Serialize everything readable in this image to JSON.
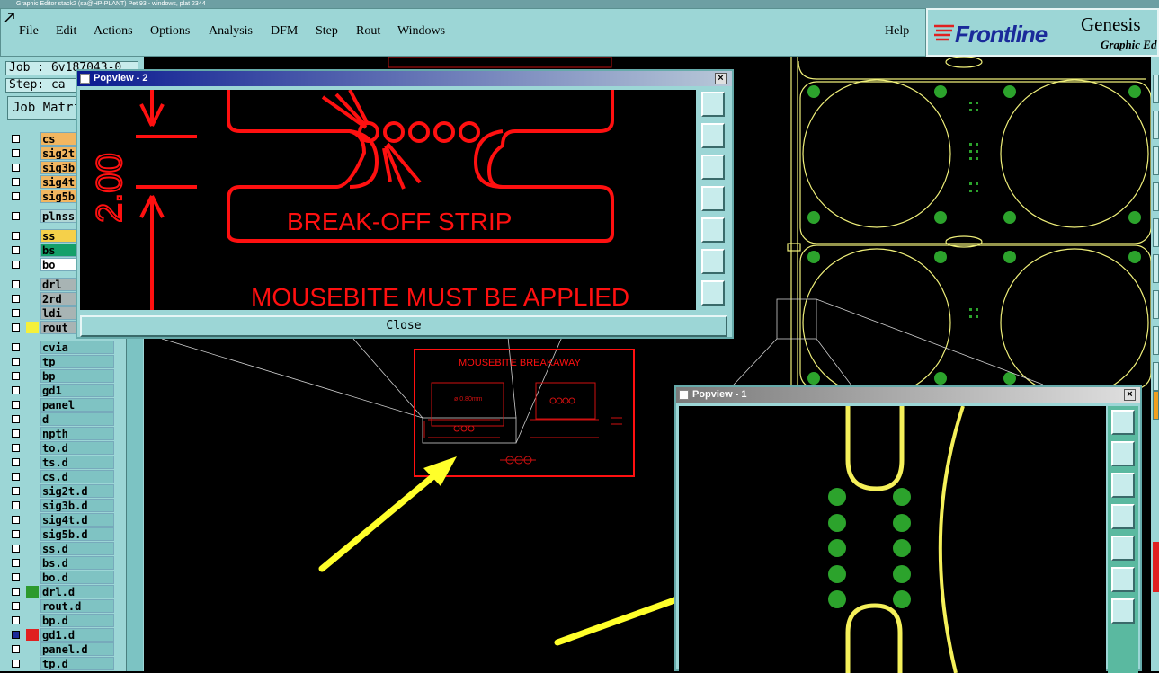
{
  "window": {
    "title": "Graphic Editor stack2 (sa@HP-PLANT) Pet 93 - windows, plat 2344"
  },
  "menu": [
    "File",
    "Edit",
    "Actions",
    "Options",
    "Analysis",
    "DFM",
    "Step",
    "Rout",
    "Windows",
    "Help"
  ],
  "brand": {
    "logo": "Frontline",
    "product": "Genesis",
    "subtitle": "Graphic Ed"
  },
  "job_info": {
    "job": "Job : 6v187043-0",
    "step": "Step: ca",
    "matrix_button": "Job Matrix"
  },
  "layers": [
    {
      "name": "cs",
      "color": "#f2b660"
    },
    {
      "name": "sig2t",
      "color": "#f2b660"
    },
    {
      "name": "sig3b",
      "color": "#f2b660"
    },
    {
      "name": "sig4t",
      "color": "#f2b660"
    },
    {
      "name": "sig5b",
      "color": "#f2b660"
    },
    {
      "name": "plnss",
      "color": "#b0d6d6"
    },
    {
      "name": "ss",
      "color": "#f5d04a"
    },
    {
      "name": "bs",
      "color": "#14a06a"
    },
    {
      "name": "bo",
      "color": "#ffffff"
    },
    {
      "name": "drl",
      "color": "#a8b4b4"
    },
    {
      "name": "2rd",
      "color": "#a8b4b4"
    },
    {
      "name": "ldi",
      "color": "#a8b4b4"
    },
    {
      "name": "rout",
      "color": "#a8b4b4",
      "swatch": "#f5f03a"
    },
    {
      "name": "cvia",
      "color": "#7fc3c3"
    },
    {
      "name": "tp",
      "color": "#7fc3c3"
    },
    {
      "name": "bp",
      "color": "#7fc3c3"
    },
    {
      "name": "gd1",
      "color": "#7fc3c3"
    },
    {
      "name": "panel",
      "color": "#7fc3c3"
    },
    {
      "name": "d",
      "color": "#7fc3c3"
    },
    {
      "name": "npth",
      "color": "#7fc3c3"
    },
    {
      "name": "to.d",
      "color": "#7fc3c3"
    },
    {
      "name": "ts.d",
      "color": "#7fc3c3"
    },
    {
      "name": "cs.d",
      "color": "#7fc3c3"
    },
    {
      "name": "sig2t.d",
      "color": "#7fc3c3"
    },
    {
      "name": "sig3b.d",
      "color": "#7fc3c3"
    },
    {
      "name": "sig4t.d",
      "color": "#7fc3c3"
    },
    {
      "name": "sig5b.d",
      "color": "#7fc3c3"
    },
    {
      "name": "ss.d",
      "color": "#7fc3c3"
    },
    {
      "name": "bs.d",
      "color": "#7fc3c3"
    },
    {
      "name": "bo.d",
      "color": "#7fc3c3"
    },
    {
      "name": "drl.d",
      "color": "#7fc3c3",
      "swatch": "#2d9a2d"
    },
    {
      "name": "rout.d",
      "color": "#7fc3c3"
    },
    {
      "name": "bp.d",
      "color": "#7fc3c3"
    },
    {
      "name": "gd1.d",
      "color": "#7fc3c3",
      "swatch": "#e02020",
      "checked": true
    },
    {
      "name": "panel.d",
      "color": "#7fc3c3"
    },
    {
      "name": "tp.d",
      "color": "#7fc3c3"
    }
  ],
  "popview2": {
    "title": "Popview - 2",
    "dimension": "2.00",
    "strip_label": "BREAK-OFF STRIP",
    "warning": "MOUSEBITE MUST BE APPLIED",
    "close_label": "Close"
  },
  "popview1": {
    "title": "Popview - 1"
  },
  "board": {
    "box_title": "MOUSEBITE BREAKAWAY",
    "detail_note": "ø 0.80mm"
  },
  "colors": {
    "ui": "#9cd6d6",
    "annotation": "#ff1010",
    "outline": "#f0f07a",
    "pad": "#2ca32c",
    "arrow": "#ffff2a"
  }
}
